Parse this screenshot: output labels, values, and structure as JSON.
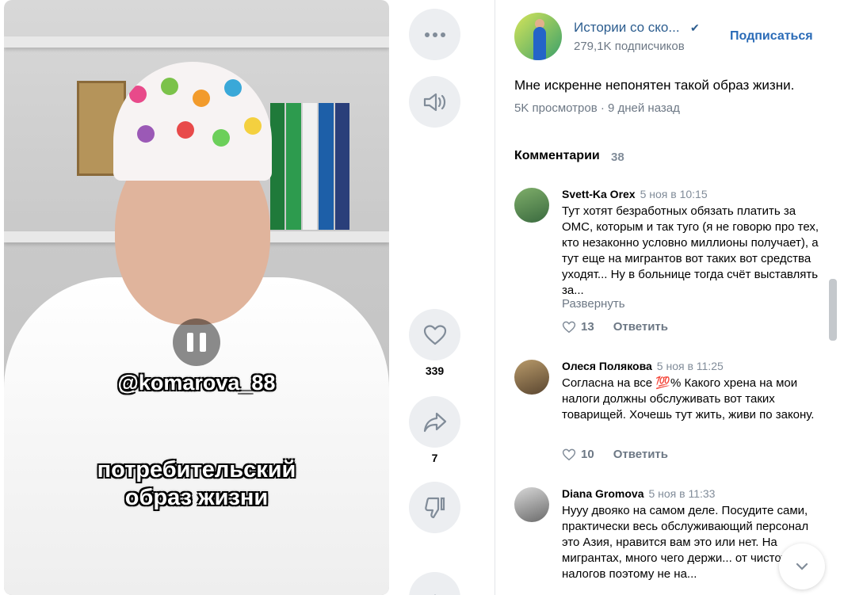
{
  "video": {
    "overlay_handle": "@komarova_88",
    "overlay_caption_line1": "потребительский",
    "overlay_caption_line2": "образ жизни",
    "state": "playing"
  },
  "actions": {
    "like_count": "339",
    "share_count": "7"
  },
  "channel": {
    "name": "Истории со ско...",
    "subscribers": "279,1K подписчиков",
    "subscribe_label": "Подписаться",
    "verified_icon": "✔"
  },
  "post": {
    "title": "Мне искренне непонятен такой образ жизни.",
    "meta": "5K просмотров · 9 дней назад"
  },
  "comments": {
    "header": "Комментарии",
    "count": "38",
    "items": [
      {
        "author": "Svett-Ka Orex",
        "date": "5 ноя в 10:15",
        "text": "Тут хотят безработных обязать платить за ОМС, которым и так туго (я не говорю про тех, кто незаконно условно миллионы получает), а тут еще на мигрантов вот таких вот средства уходят... Ну в больнице тогда счёт выставлять за...",
        "more": "Развернуть",
        "likes": "13",
        "reply": "Ответить"
      },
      {
        "author": "Олеся Полякова",
        "date": "5 ноя в 11:25",
        "text": "Согласна на все 💯% Какого хрена на мои налоги должны обслуживать вот таких товарищей. Хочешь тут жить, живи по закону.",
        "likes": "10",
        "reply": "Ответить"
      },
      {
        "author": "Diana Gromova",
        "date": "5 ноя в 11:33",
        "text": "Нууу двояко на самом деле. Посудите сами, практически весь обслуживающий персонал это Азия, нравится вам это или нет. На мигрантах, много чего держи... от чистоты до налогов поэтому не на..."
      }
    ]
  },
  "colors": {
    "link": "#2c5d8f",
    "accent": "#2a6bb7",
    "secondary_text": "#6d7885",
    "button_bg": "#eceef1"
  },
  "icons": [
    "more-icon",
    "volume-icon",
    "heart-icon",
    "share-icon",
    "dislike-icon",
    "pause-icon",
    "chevron-down-icon"
  ]
}
